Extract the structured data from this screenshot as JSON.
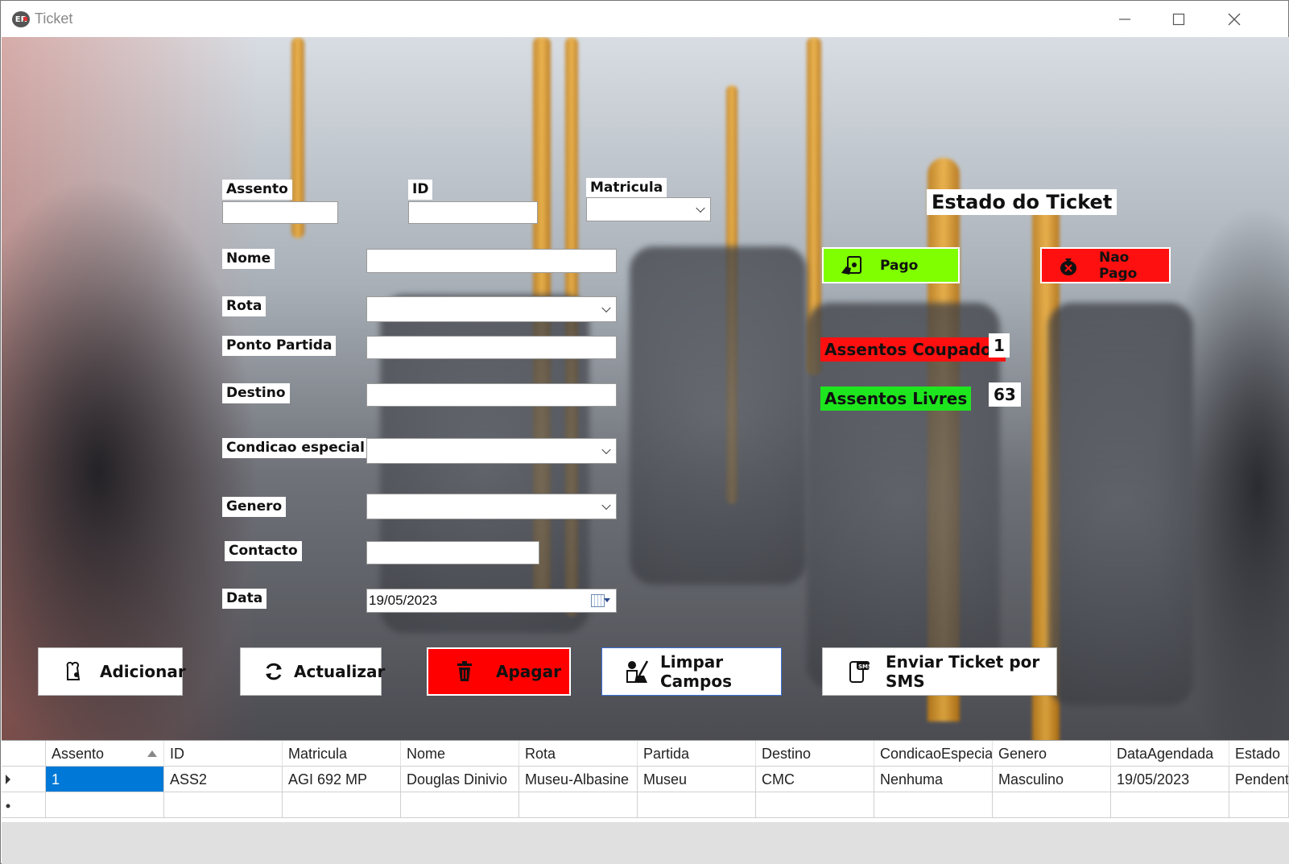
{
  "window": {
    "title": "Ticket",
    "app_icon_text": "ER"
  },
  "form": {
    "assento_label": "Assento",
    "id_label": "ID",
    "matricula_label": "Matricula",
    "nome_label": "Nome",
    "rota_label": "Rota",
    "ponto_partida_label": "Ponto Partida",
    "destino_label": "Destino",
    "condicao_label": "Condicao especial",
    "genero_label": "Genero",
    "contacto_label": "Contacto",
    "data_label": "Data",
    "data_value": "19/05/2023"
  },
  "status": {
    "title": "Estado do Ticket",
    "pago_label": "Pago",
    "nao_pago_label": "Nao Pago",
    "pago_color": "#7fff00",
    "nao_pago_color": "#ff0000"
  },
  "seats": {
    "ocupados_label": "Assentos Coupados",
    "ocupados_value": "1",
    "livres_label": "Assentos Livres",
    "livres_value": "63"
  },
  "actions": {
    "adicionar": "Adicionar",
    "actualizar": "Actualizar",
    "apagar": "Apagar",
    "limpar": "Limpar Campos",
    "enviar": "Enviar Ticket por SMS"
  },
  "table": {
    "columns": [
      "Assento",
      "ID",
      "Matricula",
      "Nome",
      "Rota",
      "Partida",
      "Destino",
      "CondicaoEspecial",
      "Genero",
      "DataAgendada",
      "Estado"
    ],
    "rows": [
      [
        "1",
        "ASS2",
        "AGI 692 MP",
        "Douglas Dinivio",
        "Museu-Albasine",
        "Museu",
        "CMC",
        "Nenhuma",
        "Masculino",
        "19/05/2023",
        "Pendente"
      ]
    ]
  }
}
